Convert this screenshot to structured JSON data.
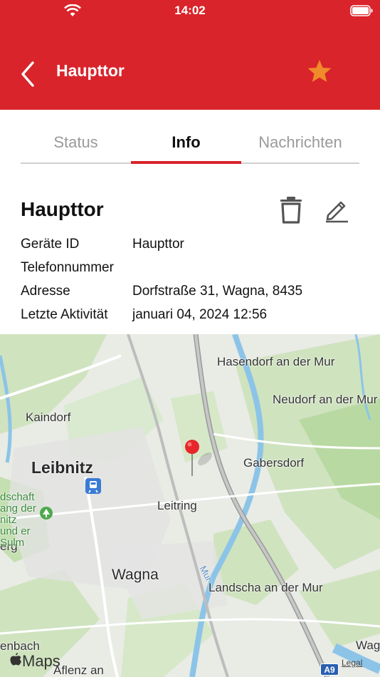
{
  "status_bar": {
    "time": "14:02"
  },
  "header": {
    "title": "Haupttor"
  },
  "tabs": [
    {
      "label": "Status"
    },
    {
      "label": "Info"
    },
    {
      "label": "Nachrichten"
    }
  ],
  "device": {
    "name": "Haupttor",
    "fields": [
      {
        "label": "Geräte ID",
        "value": "Haupttor"
      },
      {
        "label": "Telefonnummer",
        "value": ""
      },
      {
        "label": "Adresse",
        "value": "Dorfstraße 31, Wagna, 8435"
      },
      {
        "label": "Letzte Aktivität",
        "value": "januari 04, 2024 12:56"
      }
    ]
  },
  "map": {
    "places": {
      "hasendorf": "Hasendorf an der Mur",
      "neudorf": "Neudorf an der Mur",
      "kaindorf": "Kaindorf",
      "leibnitz": "Leibnitz",
      "gabersdorf": "Gabersdorf",
      "leitring": "Leitring",
      "wagna": "Wagna",
      "landscha": "Landscha an der Mur",
      "wag": "Wag",
      "aflenz": "Aflenz an",
      "enbach": "enbach",
      "erg": "erg",
      "park": "dschaft ang der nitz und er Sulm",
      "river": "Mur"
    },
    "road_badge": "A9",
    "attribution": "Maps",
    "legal": "Legal"
  },
  "colors": {
    "accent": "#d9242b",
    "star": "#f08a2a"
  }
}
